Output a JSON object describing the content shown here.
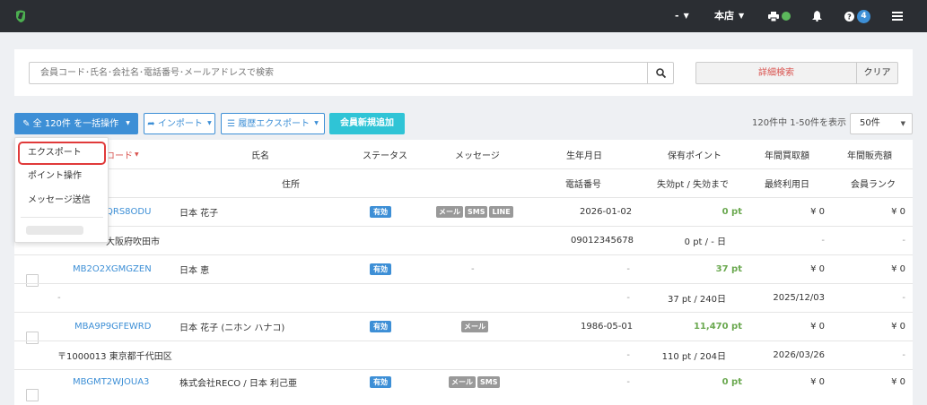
{
  "topbar": {
    "user_label": "-",
    "store_label": "本店",
    "notification_count": "4"
  },
  "search": {
    "placeholder": "会員コード･氏名･会社名･電話番号･メールアドレスで検索",
    "advanced_label": "詳細検索",
    "clear_label": "クリア"
  },
  "toolbar": {
    "bulk_label": "全 120件 を一括操作",
    "import_label": "インポート",
    "history_export_label": "履歴エクスポート",
    "add_member_label": "会員新規追加",
    "page_info": "120件中 1-50件を表示",
    "per_page": "50件"
  },
  "dropdown": {
    "items": [
      "エクスポート",
      "ポイント操作",
      "メッセージ送信"
    ]
  },
  "table": {
    "headers_row1": {
      "code": "コード",
      "name": "氏名",
      "status": "ステータス",
      "message": "メッセージ",
      "birthday": "生年月日",
      "points": "保有ポイント",
      "annual_purchase": "年間買取額",
      "annual_sales": "年間販売額"
    },
    "headers_row2": {
      "address": "住所",
      "phone": "電話番号",
      "expiry": "失効pt / 失効まで",
      "last_used": "最終利用日",
      "rank": "会員ランク"
    },
    "rows": [
      {
        "code": "QRS8ODU",
        "name": "日本 花子",
        "status": "有効",
        "tags": [
          "メール",
          "SMS",
          "LINE"
        ],
        "birthday": "2026-01-02",
        "points": "0 pt",
        "purchase": "¥ 0",
        "sales": "¥ 0",
        "address": "大阪府吹田市",
        "phone": "09012345678",
        "expiry": "0 pt / - 日",
        "last_used": "-",
        "rank": "-"
      },
      {
        "code": "MB2O2XGMGZEN",
        "name": "日本 恵",
        "status": "有効",
        "message_dash": "-",
        "birthday": "-",
        "points": "37 pt",
        "purchase": "¥ 0",
        "sales": "¥ 0",
        "address": "-",
        "phone": "-",
        "expiry": "37 pt / 240日",
        "last_used": "2025/12/03",
        "rank": "-"
      },
      {
        "code": "MBA9P9GFEWRD",
        "name": "日本 花子 (ニホン ハナコ)",
        "status": "有効",
        "tags": [
          "メール"
        ],
        "birthday": "1986-05-01",
        "points": "11,470 pt",
        "purchase": "¥ 0",
        "sales": "¥ 0",
        "address": "〒1000013 東京都千代田区",
        "phone": "-",
        "expiry": "110 pt / 204日",
        "last_used": "2026/03/26",
        "rank": "-"
      },
      {
        "code": "MBGMT2WJOUA3",
        "name": "株式会社RECO / 日本 利己亜",
        "status": "有効",
        "tags": [
          "メール",
          "SMS"
        ],
        "birthday": "-",
        "points": "0 pt",
        "purchase": "¥ 0",
        "sales": "¥ 0"
      }
    ]
  },
  "colors": {
    "topbar": "#2b2e33",
    "primary": "#3d8fd6",
    "teal": "#2fc4d6",
    "danger": "#d9534f",
    "success": "#6aa84f",
    "highlight": "#e03a3a"
  }
}
